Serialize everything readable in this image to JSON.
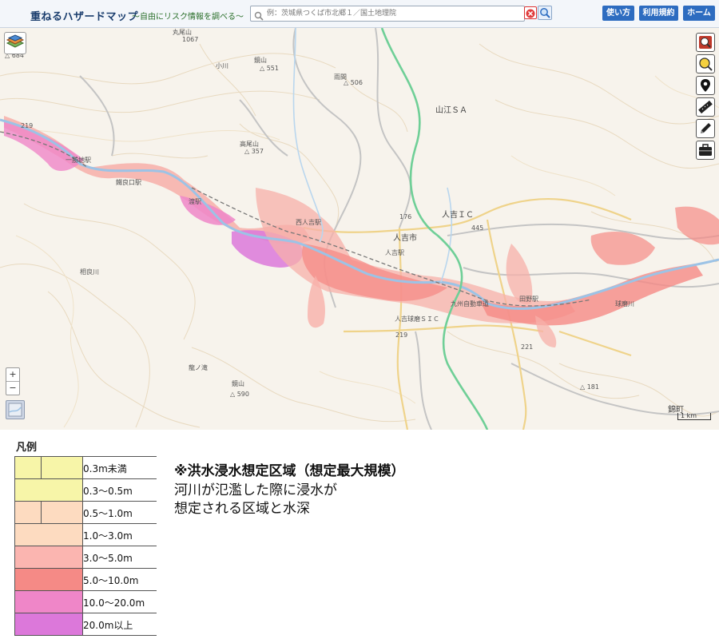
{
  "header": {
    "title": "重ねるハザードマップ",
    "subtitle": "～自由にリスク情報を調べる～",
    "search_placeholder": "例：茨城県つくば市北郷１／国土地理院",
    "buttons": [
      "使い方",
      "利用規約",
      "ホーム"
    ]
  },
  "map": {
    "labels": {
      "maruoyama": "丸尾山",
      "maruoyama_elev": "1067",
      "elev_684": "△ 684",
      "kagamiyama": "鏡山",
      "elev_551": "△ 551",
      "elev_506": "△ 506",
      "amanishi": "雨間",
      "yamae_sa": "山江ＳＡ",
      "koyama": "小川",
      "takaoyama": "高尾山",
      "elev_357": "△ 357",
      "ichiwatari_st": "一勝地駅",
      "watari_st": "渡駅",
      "ryoguchi_st": "鐵良口駅",
      "nishihitoyoshi_st": "西人吉駅",
      "hitoyoshi_ic": "人吉ＩＣ",
      "hitoyoshi_city": "人吉市",
      "hitoyoshi_st": "人吉駅",
      "elev_176": "176",
      "route_445": "445",
      "hitoyoshi_kuma_sic": "人吉球磨ＳＩＣ",
      "kyushu_expwy": "九州自動車道",
      "sagara": "相良川",
      "elev_590": "△ 590",
      "kagamiyama2": "鏡山",
      "sakura_falls": "龍ノ滝",
      "kumagawa": "球磨川",
      "route_219": "219",
      "route_221": "221",
      "elev_181": "△ 181",
      "nishikimachi": "錦町",
      "scale": "1 km",
      "route_219_west": "219",
      "kurohigashi": "田野駅"
    },
    "zoom_in": "+",
    "zoom_out": "−",
    "tools": [
      "layers-zoom-icon",
      "search-zoom-icon",
      "pin-icon",
      "ruler-icon",
      "pencil-icon",
      "toolbox-icon"
    ]
  },
  "legend": {
    "title": "凡例",
    "items": [
      {
        "label": "0.3m未満",
        "color": "#f7f5a8",
        "inner": true
      },
      {
        "label": "0.3～0.5m",
        "color": "#f7f5a8",
        "inner": false
      },
      {
        "label": "0.5～1.0m",
        "color": "#fddbc0",
        "inner": true
      },
      {
        "label": "1.0～3.0m",
        "color": "#fddbc0",
        "inner": false
      },
      {
        "label": "3.0～5.0m",
        "color": "#fbb5b0",
        "inner": false
      },
      {
        "label": "5.0～10.0m",
        "color": "#f58a86",
        "inner": false
      },
      {
        "label": "10.0～20.0m",
        "color": "#ef86c8",
        "inner": false
      },
      {
        "label": "20.0m以上",
        "color": "#dc78da",
        "inner": false
      }
    ]
  },
  "note": {
    "title": "※洪水浸水想定区域（想定最大規模）",
    "line1": "河川が氾濫した際に浸水が",
    "line2": "想定される区域と水深"
  },
  "colors": {
    "header_button": "#2d6cc0",
    "river": "#a6cbe8",
    "expressway": "#6fcf97",
    "flood_light": "#fbb5b0",
    "flood_mid": "#f58a86",
    "flood_deep": "#dc78da"
  }
}
